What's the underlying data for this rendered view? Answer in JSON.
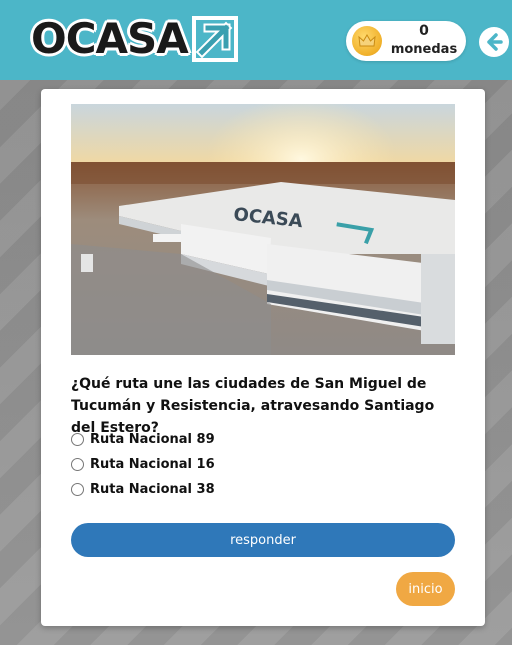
{
  "header": {
    "brand": "OCASA",
    "coins": {
      "count": "0",
      "label": "monedas",
      "icon": "crown-coin-icon"
    },
    "back_icon": "arrow-left-icon",
    "bg_color": "#4cb6c8"
  },
  "quiz": {
    "image_icon": "ocasa-warehouse-photo",
    "question": "¿Qué ruta une las ciudades de San Miguel de Tucumán y Resistencia, atravesando Santiago del Estero?",
    "options": [
      {
        "label": "Ruta Nacional 89"
      },
      {
        "label": "Ruta Nacional 16"
      },
      {
        "label": "Ruta Nacional 38"
      }
    ],
    "respond_label": "responder",
    "home_label": "inicio",
    "respond_color": "#2f78b9",
    "home_color": "#f0a843"
  }
}
